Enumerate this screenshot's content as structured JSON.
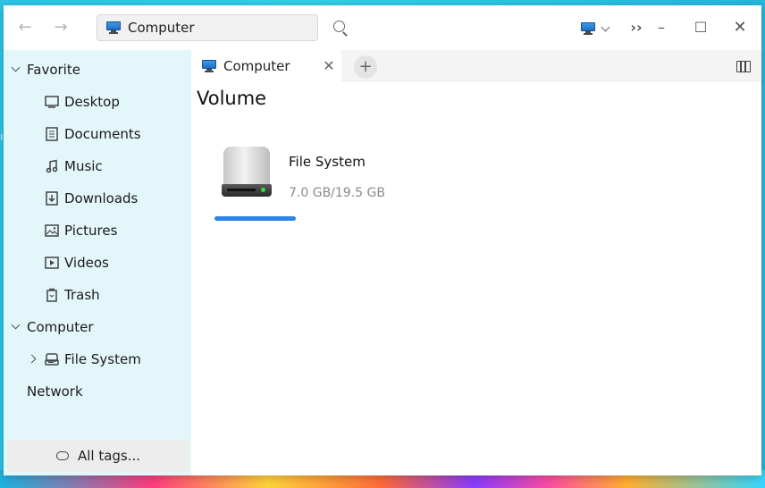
{
  "window": {
    "address": "Computer"
  },
  "sidebar": {
    "groups": [
      {
        "label": "Favorite"
      },
      {
        "label": "Computer"
      },
      {
        "label": "Network"
      }
    ],
    "favorites": [
      {
        "label": "Desktop",
        "icon": "desktop-icon"
      },
      {
        "label": "Documents",
        "icon": "document-icon"
      },
      {
        "label": "Music",
        "icon": "music-icon"
      },
      {
        "label": "Downloads",
        "icon": "download-icon"
      },
      {
        "label": "Pictures",
        "icon": "picture-icon"
      },
      {
        "label": "Videos",
        "icon": "video-icon"
      },
      {
        "label": "Trash",
        "icon": "trash-icon"
      }
    ],
    "computer_items": [
      {
        "label": "File System",
        "icon": "drive-icon"
      }
    ],
    "tags_button": "All tags..."
  },
  "tabs": [
    {
      "label": "Computer",
      "icon": "computer-icon"
    }
  ],
  "content": {
    "section_title": "Volume",
    "volumes": [
      {
        "name": "File System",
        "size": "7.0 GB/19.5 GB",
        "usage_fraction": 0.36,
        "usage_color": "#2c84e8"
      }
    ]
  },
  "colors": {
    "sidebar_bg": "#e3f7fa",
    "accent": "#2c84e8"
  }
}
